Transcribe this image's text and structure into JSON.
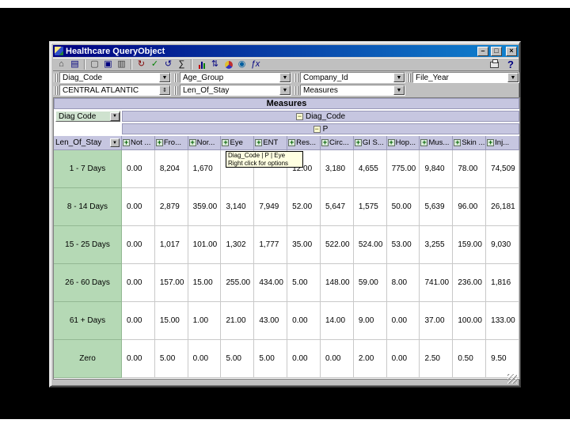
{
  "window": {
    "title": "Healthcare QueryObject"
  },
  "titlebar": {
    "minimize": "–",
    "maximize": "□",
    "close": "×"
  },
  "icons": {
    "dropdown": "▼",
    "spin": "⇕",
    "collapse": "−",
    "expand": "+"
  },
  "toolbar": {
    "help_label": "?",
    "buttons": [
      {
        "name": "exit-icon",
        "glyph": "⌂",
        "color": "#404040"
      },
      {
        "name": "design-view-icon",
        "glyph": "▤",
        "color": "#000080"
      },
      {
        "type": "sep"
      },
      {
        "name": "new-page-icon",
        "glyph": "▢",
        "color": "#404040"
      },
      {
        "name": "copy-icon",
        "glyph": "▣",
        "color": "#000080"
      },
      {
        "name": "export-icon",
        "glyph": "▥",
        "color": "#404040"
      },
      {
        "type": "sep"
      },
      {
        "name": "refresh-icon",
        "glyph": "↻",
        "color": "#800000"
      },
      {
        "name": "apply-check-icon",
        "glyph": "✓",
        "color": "#008000"
      },
      {
        "name": "rotate-pivot-icon",
        "glyph": "↺",
        "color": "#000080"
      },
      {
        "name": "sum-icon",
        "glyph": "∑",
        "color": "#000000"
      },
      {
        "type": "sep"
      },
      {
        "name": "bar-chart-icon",
        "type": "bars"
      },
      {
        "name": "sort-icon",
        "glyph": "⇅",
        "color": "#000080"
      },
      {
        "name": "pie-chart-icon",
        "type": "pie"
      },
      {
        "name": "globe-icon",
        "glyph": "◉",
        "color": "#0060a0"
      },
      {
        "name": "function-icon",
        "glyph": "ƒx",
        "color": "#000080",
        "italic": true
      }
    ]
  },
  "filters": {
    "row1": [
      {
        "label": "Diag_Code"
      },
      {
        "label": "Age_Group"
      },
      {
        "label": "Company_Id"
      },
      {
        "label": "File_Year"
      }
    ],
    "row2": [
      {
        "label": "CENTRAL ATLANTIC"
      },
      {
        "label": "Len_Of_Stay"
      },
      {
        "label": "Measures"
      }
    ]
  },
  "pivot": {
    "measures_label": "Measures",
    "col_dimension_label": "Diag_Code",
    "page_label": "P",
    "row_dim_button_label": "Diag Code",
    "row_axis_label": "Len_Of_Stay",
    "columns": [
      "Not ...",
      "Fro...",
      "Nor...",
      "Eye",
      "ENT",
      "Res...",
      "Circ...",
      "GI S...",
      "Hop...",
      "Mus...",
      "Skin ...",
      "Inj..."
    ],
    "rows": [
      {
        "label": "1 - 7 Days",
        "values": [
          "0.00",
          "8,204",
          "1,670",
          "",
          "",
          "12.00",
          "3,180",
          "4,655",
          "775.00",
          "9,840",
          "78.00",
          "74,509"
        ]
      },
      {
        "label": "8 - 14 Days",
        "values": [
          "0.00",
          "2,879",
          "359.00",
          "3,140",
          "7,949",
          "52.00",
          "5,647",
          "1,575",
          "50.00",
          "5,639",
          "96.00",
          "26,181"
        ]
      },
      {
        "label": "15 - 25 Days",
        "values": [
          "0.00",
          "1,017",
          "101.00",
          "1,302",
          "1,777",
          "35.00",
          "522.00",
          "524.00",
          "53.00",
          "3,255",
          "159.00",
          "9,030"
        ]
      },
      {
        "label": "26 - 60 Days",
        "values": [
          "0.00",
          "157.00",
          "15.00",
          "255.00",
          "434.00",
          "5.00",
          "148.00",
          "59.00",
          "8.00",
          "741.00",
          "236.00",
          "1,816"
        ]
      },
      {
        "label": "61 + Days",
        "values": [
          "0.00",
          "15.00",
          "1.00",
          "21.00",
          "43.00",
          "0.00",
          "14.00",
          "9.00",
          "0.00",
          "37.00",
          "100.00",
          "133.00"
        ]
      },
      {
        "label": "Zero",
        "values": [
          "0.00",
          "5.00",
          "0.00",
          "5.00",
          "5.00",
          "0.00",
          "0.00",
          "2.00",
          "0.00",
          "2.50",
          "0.50",
          "9.50"
        ]
      }
    ]
  },
  "tooltip": {
    "line1": "Diag_Code | P | Eye",
    "line2": "Right click for options"
  },
  "colors": {
    "titlebar": "#000080",
    "header_band": "#c6c6e0",
    "row_label": "#b5d9b5",
    "tooltip_bg": "#ffffe1"
  }
}
